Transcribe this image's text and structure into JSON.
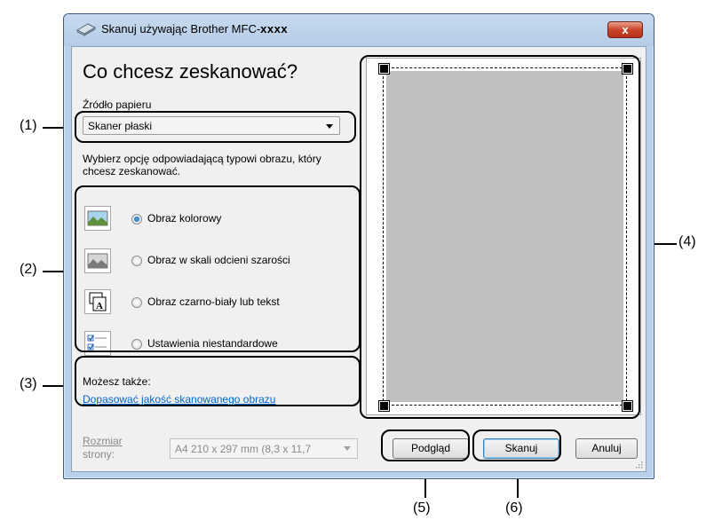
{
  "window": {
    "title_prefix": "Skanuj używając Brother MFC-",
    "title_model": "xxxx",
    "close_label": "x"
  },
  "main": {
    "heading": "Co chcesz zeskanować?",
    "paper_source_label": "Źródło papieru",
    "paper_source_value": "Skaner płaski",
    "instruction": "Wybierz opcję odpowiadającą typowi obrazu, który chcesz zeskanować.",
    "options": [
      {
        "label": "Obraz kolorowy",
        "selected": true,
        "icon": "color-photo-icon"
      },
      {
        "label": "Obraz w skali odcieni szarości",
        "selected": false,
        "icon": "grayscale-photo-icon"
      },
      {
        "label": "Obraz czarno-biały lub tekst",
        "selected": false,
        "icon": "bw-text-icon"
      },
      {
        "label": "Ustawienia niestandardowe",
        "selected": false,
        "icon": "custom-settings-icon"
      }
    ],
    "also_label": "Możesz także:",
    "adjust_link": "Dopasować jakość skanowanego obrazu",
    "page_size_label_1": "Rozmiar",
    "page_size_label_2": "strony:",
    "page_size_value": "A4 210 x 297 mm (8,3 x 11,7"
  },
  "buttons": {
    "preview": "Podgląd",
    "scan": "Skanuj",
    "cancel": "Anuluj"
  },
  "annotations": {
    "a1": "(1)",
    "a2": "(2)",
    "a3": "(3)",
    "a4": "(4)",
    "a5": "(5)",
    "a6": "(6)"
  },
  "colors": {
    "link": "#0066cc",
    "selected_radio": "#1b5ea6",
    "close_button": "#c8452a"
  }
}
